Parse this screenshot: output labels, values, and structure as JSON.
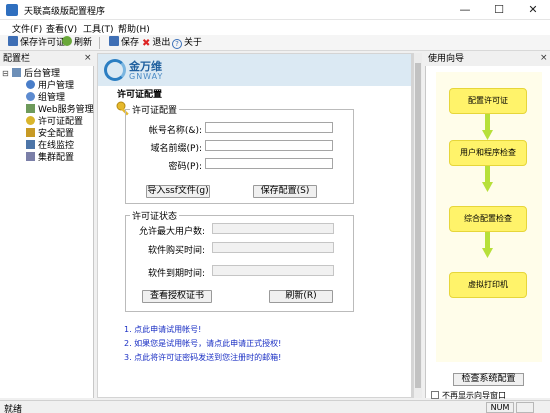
{
  "window": {
    "title": "天联高级版配置程序"
  },
  "menu": [
    "文件(F)",
    "查看(V)",
    "工具(T)",
    "帮助(H)"
  ],
  "toolbar": {
    "save_license": "保存许可证",
    "refresh": "刷新",
    "save": "保存",
    "exit": "退出",
    "about": "关于"
  },
  "config_panel": {
    "title": "配置栏",
    "close": "×",
    "root": "后台管理",
    "items": [
      "用户管理",
      "组管理",
      "Web服务管理",
      "许可证配置",
      "安全配置",
      "在线监控",
      "集群配置"
    ]
  },
  "brand": {
    "name_cn": "金万维",
    "name_en": "GNWAY"
  },
  "license_page": {
    "title": "许可证配置",
    "config_group": "许可证配置",
    "account_label": "帐号名称(&):",
    "domain_label": "域名前缀(P):",
    "password_label": "密码(P):",
    "import_button": "导入ssf文件(g)",
    "save_config_button": "保存配置(S)",
    "status_group": "许可证状态",
    "max_users_label": "允许最大用户数:",
    "purchase_time_label": "软件购买时间:",
    "expire_time_label": "软件到期时间:",
    "view_cert_button": "查看授权证书",
    "refresh_button": "刷新(R)"
  },
  "links": [
    "1. 点此申请试用帐号!",
    "2. 如果您是试用帐号，请点此申请正式授权!",
    "3. 点此将许可证密码发送到您注册时的邮箱!"
  ],
  "wizard": {
    "title": "使用向导",
    "close": "×",
    "steps": [
      "配置许可证",
      "用户和程序检查",
      "综合配置检查",
      "虚拟打印机"
    ],
    "check_button": "检查系统配置",
    "checkbox_label": "不再显示向导窗口"
  },
  "status": {
    "text": "就绪",
    "num": "NUM"
  },
  "colors": {
    "step_fill": "#fff36a",
    "arrow": "#b7e03a",
    "link": "#1a2fc4",
    "brand": "#1f5f9e"
  }
}
